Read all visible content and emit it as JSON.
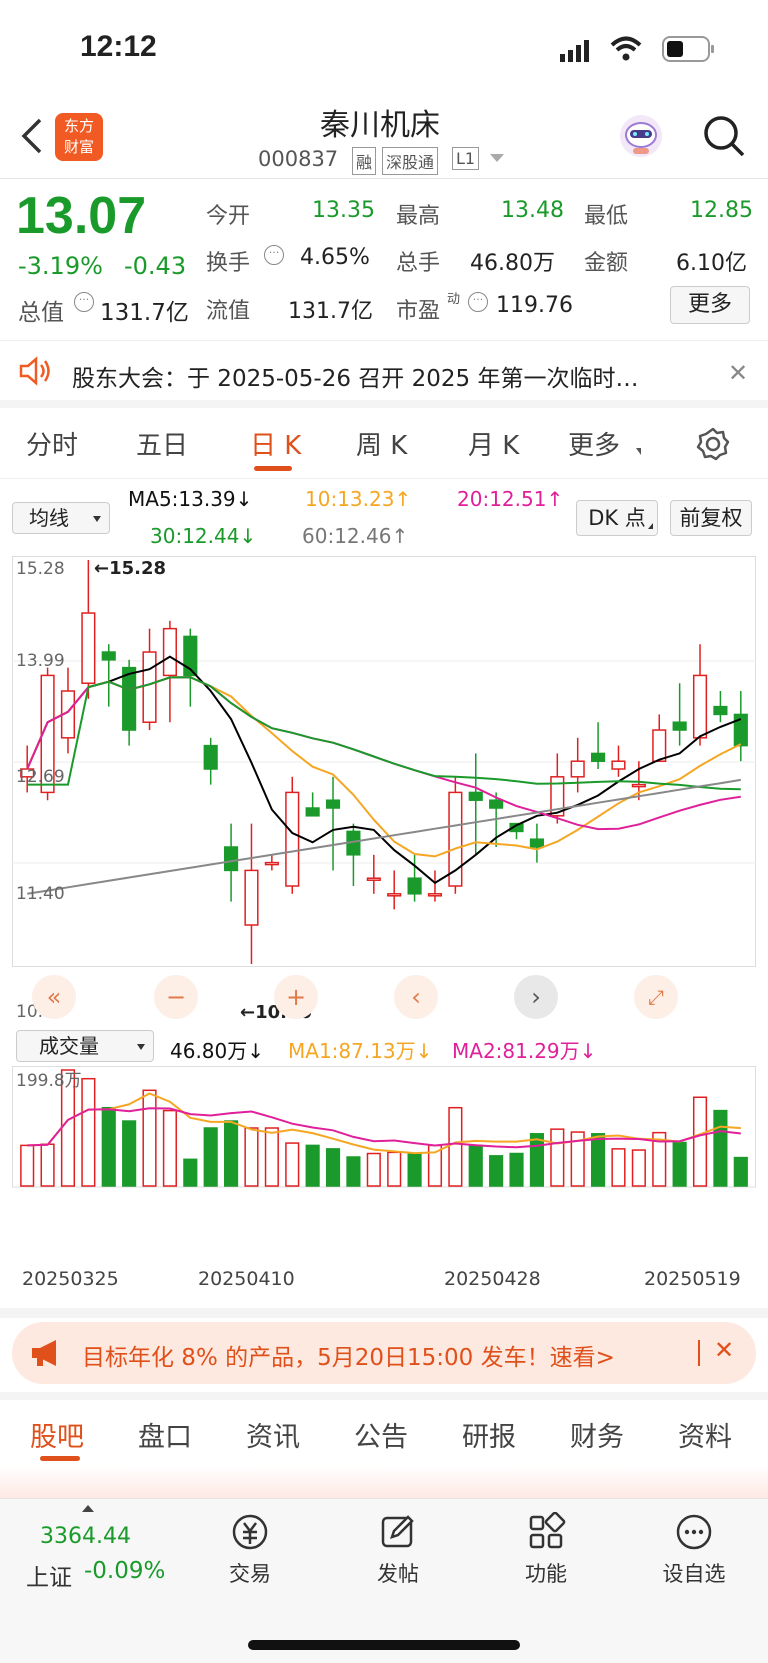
{
  "status": {
    "time": "12:12"
  },
  "header": {
    "logo_line1": "东方",
    "logo_line2": "财富",
    "title": "秦川机床",
    "code": "000837",
    "tags": [
      "融",
      "深股通",
      "L1"
    ]
  },
  "quote": {
    "price": "13.07",
    "pct": "-3.19%",
    "chg": "-0.43",
    "open_label": "今开",
    "open": "13.35",
    "high_label": "最高",
    "high": "13.48",
    "low_label": "最低",
    "low": "12.85",
    "turn_label": "换手",
    "turn": "4.65%",
    "vol_label": "总手",
    "vol": "46.80万",
    "amt_label": "金额",
    "amt": "6.10亿",
    "mcap_label": "总值",
    "mcap": "131.7亿",
    "float_label": "流值",
    "float": "131.7亿",
    "pe_label": "市盈",
    "pe_sup": "动",
    "pe": "119.76",
    "more": "更多"
  },
  "notice": {
    "text": "股东大会：于 2025-05-26 召开 2025 年第一次临时…"
  },
  "tabs": [
    "分时",
    "五日",
    "日 K",
    "周 K",
    "月 K",
    "更多"
  ],
  "ma": {
    "select": "均线",
    "ma5": "MA5:13.39↓",
    "ma10": "10:13.23↑",
    "ma20": "20:12.51↑",
    "ma30": "30:12.44↓",
    "ma60": "60:12.46↑",
    "dk": "DK 点",
    "fq": "前复权"
  },
  "kline": {
    "y_labels": [
      "15.28",
      "13.99",
      "12.69",
      "11.40",
      "10.10"
    ],
    "high_mark": "←15.28",
    "low_mark": "←10.10"
  },
  "volume": {
    "select": "成交量",
    "vol": "46.80万↓",
    "ma1": "MA1:87.13万↓",
    "ma2": "MA2:81.29万↓",
    "max": "199.8万",
    "dates": [
      "20250325",
      "20250410",
      "20250428",
      "20250519"
    ]
  },
  "banner": {
    "text": "目标年化 8% 的产品，5月20日15:00 发车！速看>"
  },
  "bottom_tabs": [
    "股吧",
    "盘口",
    "资讯",
    "公告",
    "研报",
    "财务",
    "资料"
  ],
  "dock": {
    "index_value": "3364.44",
    "index_name": "上证",
    "index_pct": "-0.09%",
    "items": [
      "交易",
      "发帖",
      "功能",
      "设自选"
    ]
  },
  "colors": {
    "up": "#e02020",
    "down": "#1a9a2a",
    "ma5": "#000000",
    "ma10": "#f5a623",
    "ma20": "#e0209a",
    "ma30": "#1a9a2a",
    "ma60": "#888888"
  },
  "chart_data": {
    "type": "candlestick",
    "ylim": [
      10.1,
      15.28
    ],
    "candles": [
      [
        12.5,
        12.6,
        12.9,
        12.3
      ],
      [
        12.3,
        13.8,
        13.9,
        12.2
      ],
      [
        13.0,
        13.6,
        13.9,
        12.8
      ],
      [
        13.7,
        14.6,
        15.28,
        13.5
      ],
      [
        14.1,
        14.0,
        14.2,
        13.4
      ],
      [
        13.9,
        13.1,
        14.0,
        12.9
      ],
      [
        13.2,
        14.1,
        14.4,
        13.1
      ],
      [
        13.8,
        14.4,
        14.5,
        13.2
      ],
      [
        14.3,
        13.8,
        14.4,
        13.4
      ],
      [
        12.9,
        12.6,
        13.0,
        12.4
      ],
      [
        11.6,
        11.3,
        11.9,
        10.9
      ],
      [
        10.6,
        11.3,
        11.9,
        10.1
      ],
      [
        11.4,
        11.4,
        11.5,
        11.3
      ],
      [
        11.1,
        12.3,
        12.5,
        11.0
      ],
      [
        12.1,
        12.0,
        12.3,
        12.0
      ],
      [
        12.2,
        12.1,
        12.5,
        11.3
      ],
      [
        11.8,
        11.5,
        11.9,
        11.1
      ],
      [
        11.2,
        11.2,
        11.5,
        11.0
      ],
      [
        11.0,
        11.0,
        11.3,
        10.8
      ],
      [
        11.2,
        11.0,
        11.5,
        10.9
      ],
      [
        11.0,
        11.0,
        11.3,
        10.9
      ],
      [
        11.1,
        12.3,
        12.5,
        11.0
      ],
      [
        12.3,
        12.2,
        12.8,
        11.5
      ],
      [
        12.2,
        12.1,
        12.3,
        11.6
      ],
      [
        11.9,
        11.8,
        11.9,
        11.7
      ],
      [
        11.7,
        11.6,
        11.9,
        11.4
      ],
      [
        12.0,
        12.5,
        12.8,
        11.9
      ],
      [
        12.5,
        12.7,
        13.0,
        12.3
      ],
      [
        12.8,
        12.7,
        13.2,
        12.6
      ],
      [
        12.6,
        12.7,
        12.9,
        12.5
      ],
      [
        12.4,
        12.4,
        12.7,
        12.2
      ],
      [
        12.7,
        13.1,
        13.3,
        12.7
      ],
      [
        13.2,
        13.1,
        13.7,
        12.9
      ],
      [
        13.0,
        13.8,
        14.2,
        12.9
      ],
      [
        13.4,
        13.3,
        13.6,
        13.2
      ],
      [
        13.3,
        12.9,
        13.6,
        12.7
      ]
    ],
    "volume": [
      70,
      72,
      200,
      185,
      135,
      112,
      165,
      130,
      46,
      100,
      112,
      100,
      100,
      74,
      70,
      64,
      50,
      56,
      58,
      56,
      70,
      135,
      70,
      52,
      56,
      90,
      98,
      93,
      90,
      64,
      62,
      92,
      75,
      153,
      130,
      49
    ],
    "series": [
      {
        "name": "MA5"
      },
      {
        "name": "MA10"
      },
      {
        "name": "MA20"
      },
      {
        "name": "MA30"
      },
      {
        "name": "MA60"
      }
    ]
  }
}
